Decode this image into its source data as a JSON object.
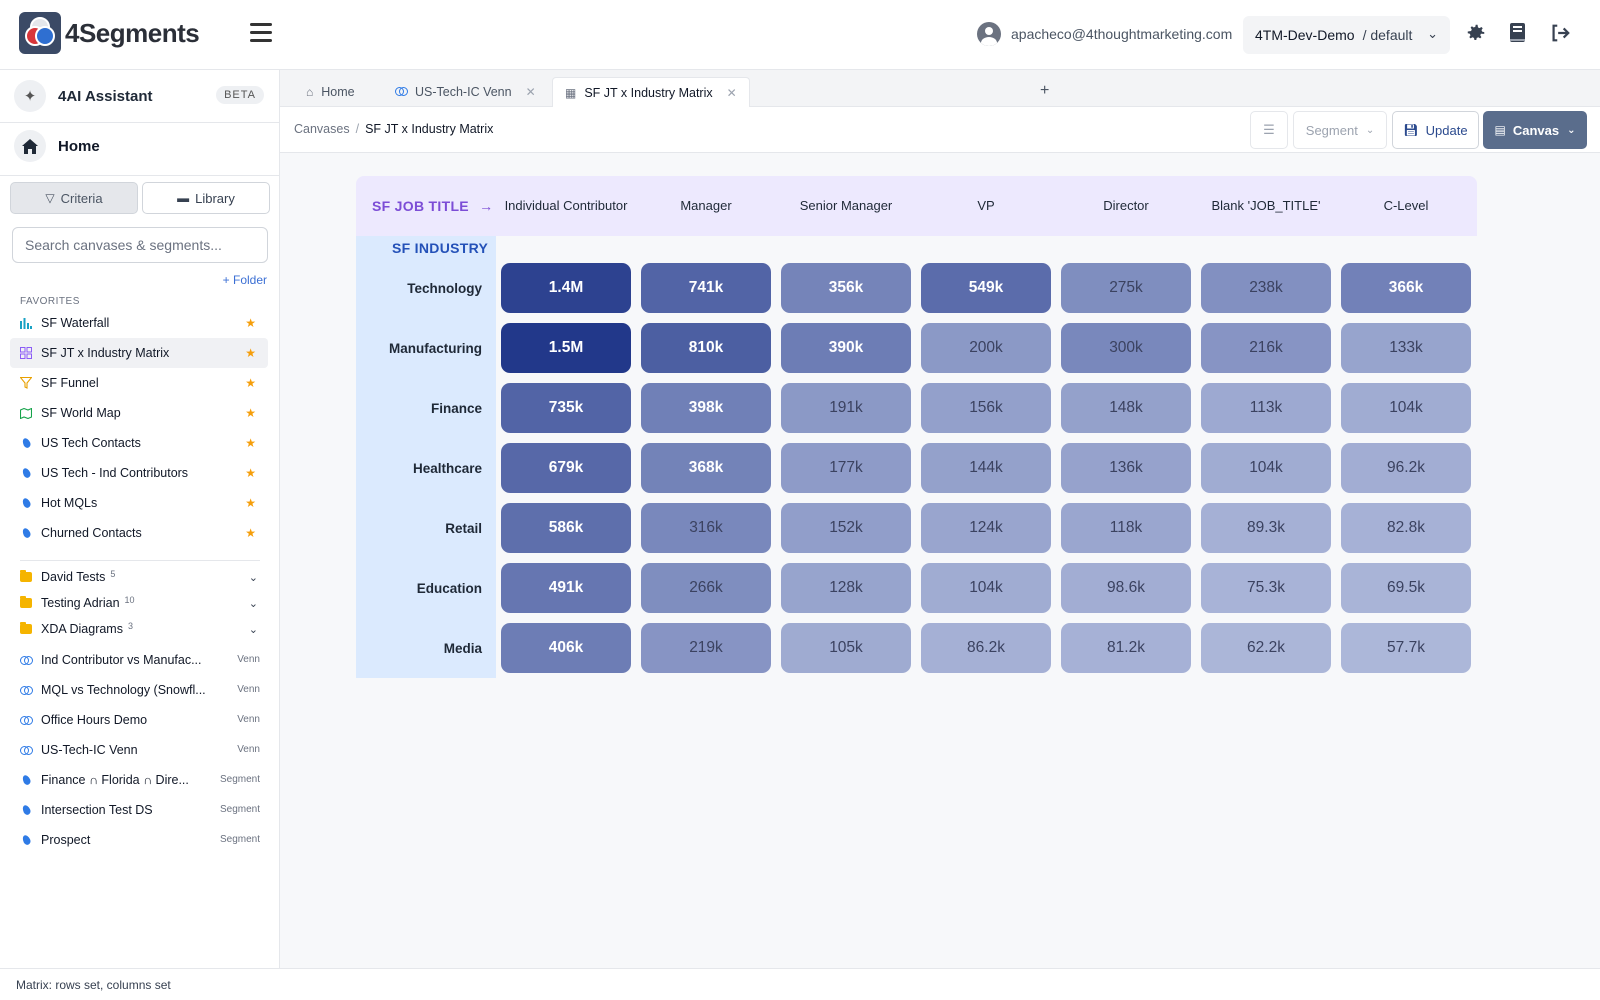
{
  "app": {
    "logo_text": "4Segments",
    "user_email": "apacheco@4thoughtmarketing.com",
    "org": "4TM-Dev-Demo",
    "env": "/ default"
  },
  "sidebar": {
    "assistant_label": "4AI Assistant",
    "beta_badge": "BETA",
    "home_label": "Home",
    "criteria_label": "Criteria",
    "library_label": "Library",
    "search_placeholder": "Search canvases & segments...",
    "add_folder": "+ Folder",
    "favorites_title": "FAVORITES",
    "favorites": [
      {
        "label": "SF Waterfall",
        "icon": "waterfall-icon"
      },
      {
        "label": "SF JT x Industry Matrix",
        "icon": "matrix-icon"
      },
      {
        "label": "SF Funnel",
        "icon": "funnel-icon"
      },
      {
        "label": "SF World Map",
        "icon": "map-icon"
      },
      {
        "label": "US Tech Contacts",
        "icon": "segment-icon"
      },
      {
        "label": "US Tech - Ind Contributors",
        "icon": "segment-icon"
      },
      {
        "label": "Hot MQLs",
        "icon": "segment-icon"
      },
      {
        "label": "Churned Contacts",
        "icon": "segment-icon"
      }
    ],
    "folders": [
      {
        "label": "David Tests",
        "count": "5"
      },
      {
        "label": "Testing Adrian",
        "count": "10"
      },
      {
        "label": "XDA Diagrams",
        "count": "3"
      }
    ],
    "library": [
      {
        "label": "Ind Contributor vs Manufac...",
        "tag": "Venn"
      },
      {
        "label": "MQL vs Technology (Snowfl...",
        "tag": "Venn"
      },
      {
        "label": "Office Hours Demo",
        "tag": "Venn"
      },
      {
        "label": "US-Tech-IC Venn",
        "tag": "Venn"
      },
      {
        "label": "Finance ∩ Florida ∩ Dire...",
        "tag": "Segment"
      },
      {
        "label": "Intersection Test DS",
        "tag": "Segment"
      },
      {
        "label": "Prospect",
        "tag": "Segment"
      }
    ]
  },
  "tabs": [
    {
      "label": "Home"
    },
    {
      "label": "US-Tech-IC Venn"
    },
    {
      "label": "SF JT x Industry Matrix"
    }
  ],
  "toolbar": {
    "crumb_root": "Canvases",
    "crumb_current": "SF JT x Industry Matrix",
    "segment_label": "Segment",
    "update_label": "Update",
    "canvas_label": "Canvas"
  },
  "matrix": {
    "col_axis_label": "SF JOB TITLE",
    "row_axis_label": "SF INDUSTRY",
    "columns": [
      "Individual Contributor",
      "Manager",
      "Senior Manager",
      "VP",
      "Director",
      "Blank 'JOB_TITLE'",
      "C-Level"
    ],
    "rows": [
      {
        "label": "Technology",
        "values": [
          "1.4M",
          "741k",
          "356k",
          "549k",
          "275k",
          "238k",
          "366k"
        ],
        "intensity": [
          0.93,
          0.68,
          0.45,
          0.62,
          0.38,
          0.36,
          0.47
        ]
      },
      {
        "label": "Manufacturing",
        "values": [
          "1.5M",
          "810k",
          "390k",
          "200k",
          "300k",
          "216k",
          "133k"
        ],
        "intensity": [
          1.0,
          0.72,
          0.5,
          0.3,
          0.42,
          0.33,
          0.22
        ]
      },
      {
        "label": "Finance",
        "values": [
          "735k",
          "398k",
          "191k",
          "156k",
          "148k",
          "113k",
          "104k"
        ],
        "intensity": [
          0.68,
          0.48,
          0.3,
          0.25,
          0.24,
          0.18,
          0.16
        ]
      },
      {
        "label": "Healthcare",
        "values": [
          "679k",
          "368k",
          "177k",
          "144k",
          "136k",
          "104k",
          "96.2k"
        ],
        "intensity": [
          0.65,
          0.46,
          0.28,
          0.24,
          0.23,
          0.16,
          0.15
        ]
      },
      {
        "label": "Retail",
        "values": [
          "586k",
          "316k",
          "152k",
          "124k",
          "118k",
          "89.3k",
          "82.8k"
        ],
        "intensity": [
          0.6,
          0.42,
          0.26,
          0.21,
          0.2,
          0.13,
          0.12
        ]
      },
      {
        "label": "Education",
        "values": [
          "491k",
          "266k",
          "128k",
          "104k",
          "98.6k",
          "75.3k",
          "69.5k"
        ],
        "intensity": [
          0.55,
          0.38,
          0.22,
          0.16,
          0.15,
          0.11,
          0.1
        ]
      },
      {
        "label": "Media",
        "values": [
          "406k",
          "219k",
          "105k",
          "86.2k",
          "81.2k",
          "62.2k",
          "57.7k"
        ],
        "intensity": [
          0.5,
          0.33,
          0.17,
          0.13,
          0.12,
          0.09,
          0.08
        ]
      }
    ],
    "colors": {
      "low": "#b8c2e0",
      "high": "#22388a"
    }
  },
  "status_text": "Matrix: rows set, columns set"
}
